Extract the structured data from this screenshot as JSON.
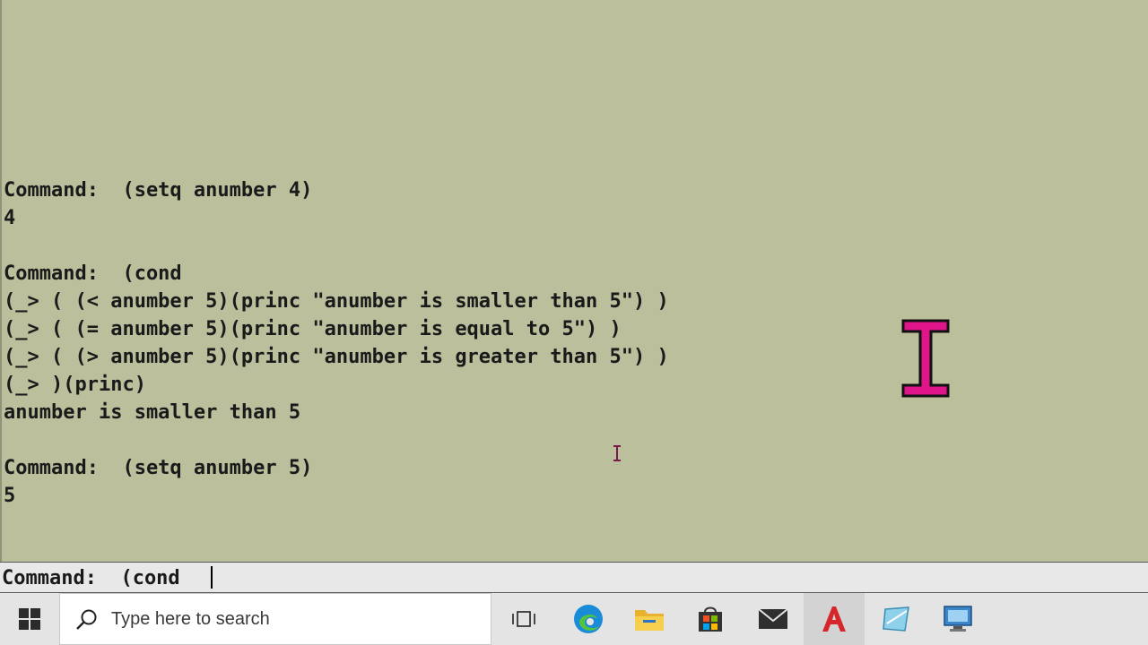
{
  "console": {
    "history": [
      "Command:  (setq anumber 4)",
      "4",
      "",
      "Command:  (cond",
      "(_> ( (< anumber 5)(princ \"anumber is smaller than 5\") )",
      "(_> ( (= anumber 5)(princ \"anumber is equal to 5\") )",
      "(_> ( (> anumber 5)(princ \"anumber is greater than 5\") )",
      "(_> )(princ)",
      "anumber is smaller than 5",
      "",
      "Command:  (setq anumber 5)",
      "5"
    ],
    "current_input": "Command:  (cond "
  },
  "taskbar": {
    "search_placeholder": "Type here to search",
    "icons": [
      "windows-start-icon",
      "search-icon",
      "task-view-icon",
      "edge-icon",
      "file-explorer-icon",
      "store-icon",
      "mail-icon",
      "autocad-icon",
      "app-icon",
      "remote-desktop-icon"
    ]
  },
  "colors": {
    "console_bg": "#bbbf9c",
    "text": "#1a1a1a",
    "cursor_magenta": "#e0158a"
  }
}
